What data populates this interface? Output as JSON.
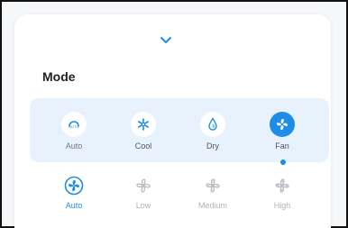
{
  "panel": {
    "title": "Mode",
    "collapse_icon": "chevron-down-icon"
  },
  "modes": [
    {
      "label": "Auto",
      "icon": "auto-mode-icon",
      "selected": false
    },
    {
      "label": "Cool",
      "icon": "snowflake-icon",
      "selected": false
    },
    {
      "label": "Dry",
      "icon": "droplet-icon",
      "selected": false
    },
    {
      "label": "Fan",
      "icon": "fan-icon",
      "selected": true
    }
  ],
  "fan_speeds": [
    {
      "label": "Auto",
      "icon": "fan-auto-icon",
      "selected": true
    },
    {
      "label": "Low",
      "icon": "fan-low-icon",
      "selected": false
    },
    {
      "label": "Medium",
      "icon": "fan-medium-icon",
      "selected": false
    },
    {
      "label": "High",
      "icon": "fan-high-icon",
      "selected": false
    }
  ],
  "colors": {
    "accent": "#1d8de8",
    "panel_bg": "#e7f2fc",
    "inactive_icon": "#b8bcc2"
  }
}
